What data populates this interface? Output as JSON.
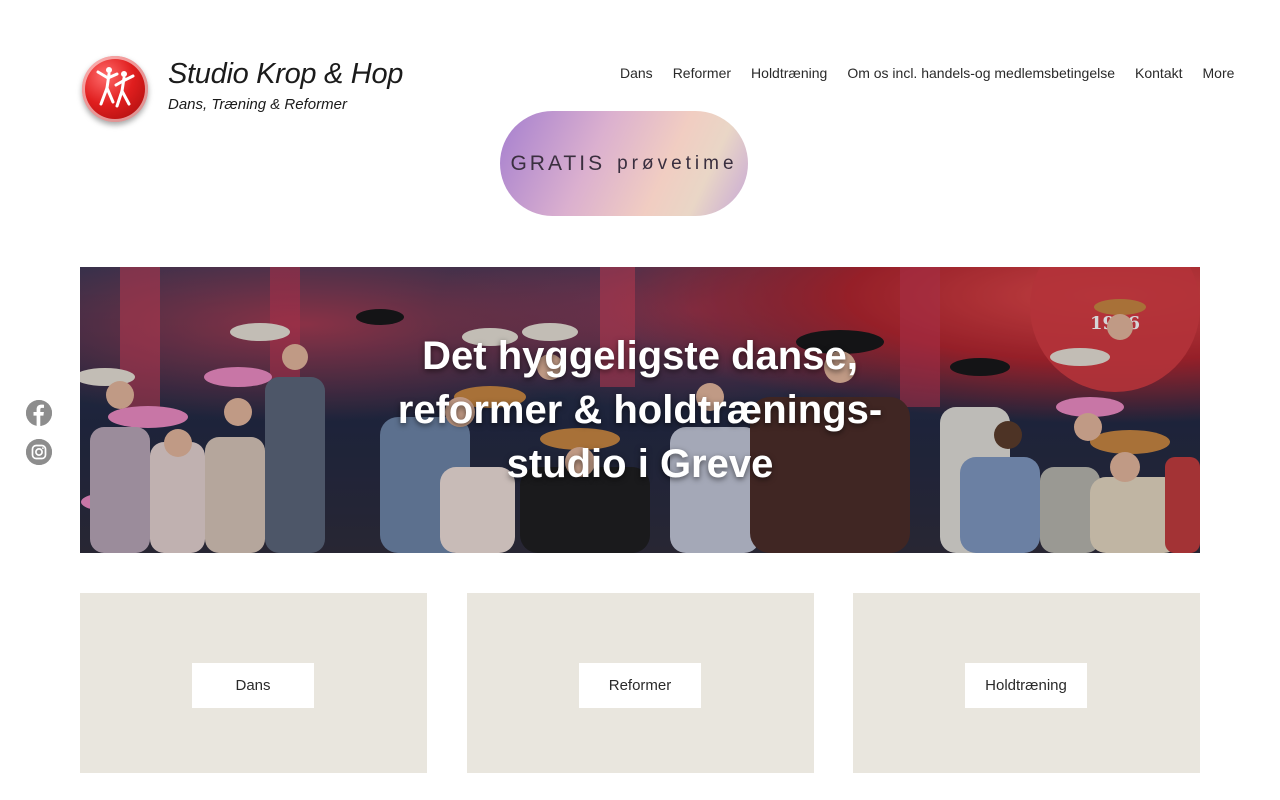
{
  "brand": {
    "title": "Studio Krop & Hop",
    "subtitle": "Dans, Træning & Reformer",
    "logo_icon": "dancers-logo-icon"
  },
  "nav": {
    "items": [
      {
        "label": "Dans"
      },
      {
        "label": "Reformer"
      },
      {
        "label": "Holdtræning"
      },
      {
        "label": "Om os incl. handels-og medlemsbetingelse"
      },
      {
        "label": "Kontakt"
      },
      {
        "label": "More"
      }
    ]
  },
  "cta": {
    "main": "GRATIS",
    "small": "prøvetime"
  },
  "hero": {
    "title": "Det hyggeligste danse, reformer & holdtrænings- studio i Greve",
    "image_badge": "1996"
  },
  "social": {
    "items": [
      {
        "icon": "facebook-icon"
      },
      {
        "icon": "instagram-icon"
      }
    ]
  },
  "cards": [
    {
      "label": "Dans"
    },
    {
      "label": "Reformer"
    },
    {
      "label": "Holdtræning"
    }
  ],
  "colors": {
    "card_bg": "#e9e6de",
    "social_gray": "#8d8d8d",
    "logo_red": "#e01e1e"
  }
}
